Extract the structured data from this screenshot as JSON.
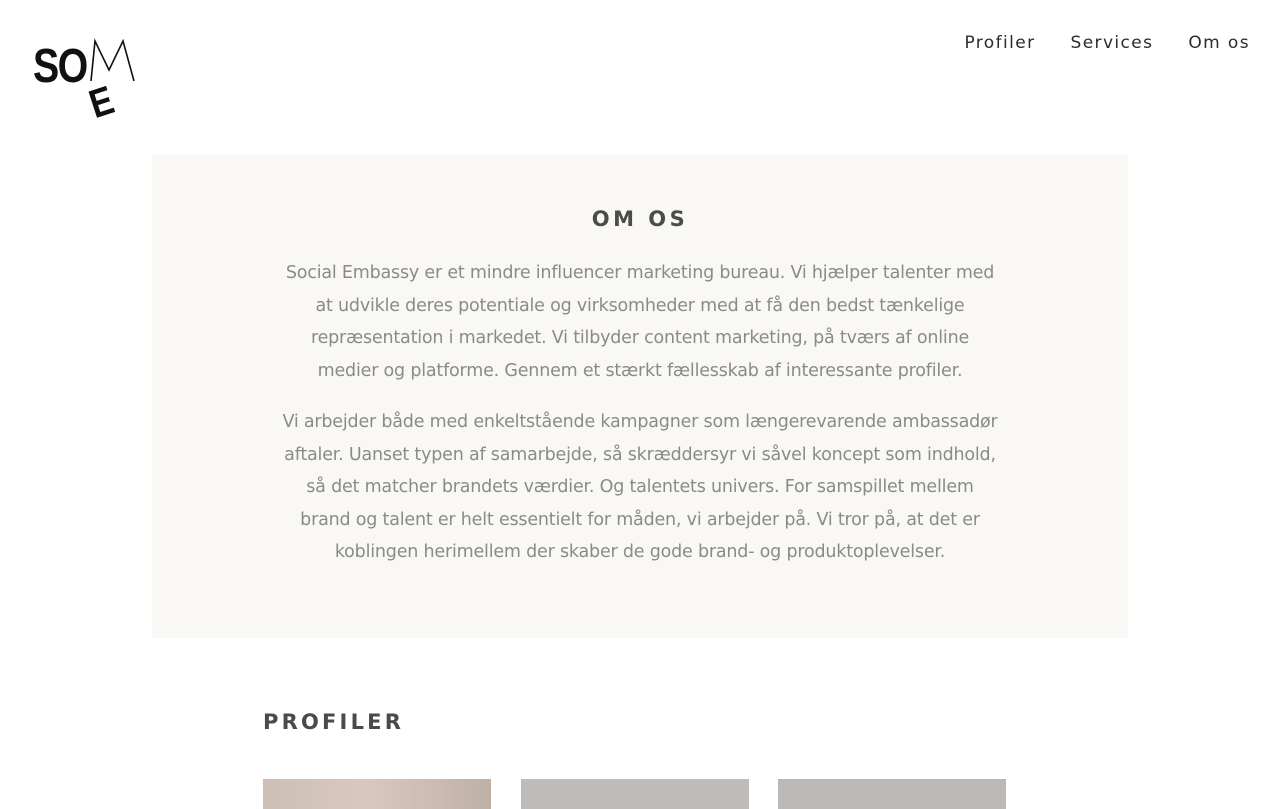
{
  "header": {
    "logo_text": "SOME",
    "nav": [
      {
        "label": "Profiler"
      },
      {
        "label": "Services"
      },
      {
        "label": "Om os"
      }
    ]
  },
  "about": {
    "title": "OM OS",
    "paragraphs": [
      "Social Embassy er et mindre influencer marketing bureau. Vi hjælper talenter med at udvikle deres potentiale og virksomheder med at få den bedst tænkelige repræsentation i markedet. Vi tilbyder content marketing, på tværs af online medier og platforme. Gennem et stærkt fællesskab af interessante profiler.",
      "Vi arbejder både med enkeltstående kampagner som længerevarende ambassadør aftaler. Uanset typen af samarbejde, så skræddersyr vi såvel koncept som indhold, så det matcher brandets værdier. Og talentets univers. For samspillet mellem brand og talent er helt essentielt for måden, vi arbejder på. Vi tror på, at det er koblingen herimellem der skaber de gode brand- og produktoplevelser."
    ]
  },
  "profiles": {
    "title": "PROFILER",
    "cards": [
      {
        "name": "profile-card-1"
      },
      {
        "name": "profile-card-2"
      },
      {
        "name": "profile-card-3"
      }
    ]
  },
  "colors": {
    "about_bg": "#f9f8f5",
    "body_text": "#8a8a8a",
    "heading": "#4b4b4b"
  }
}
